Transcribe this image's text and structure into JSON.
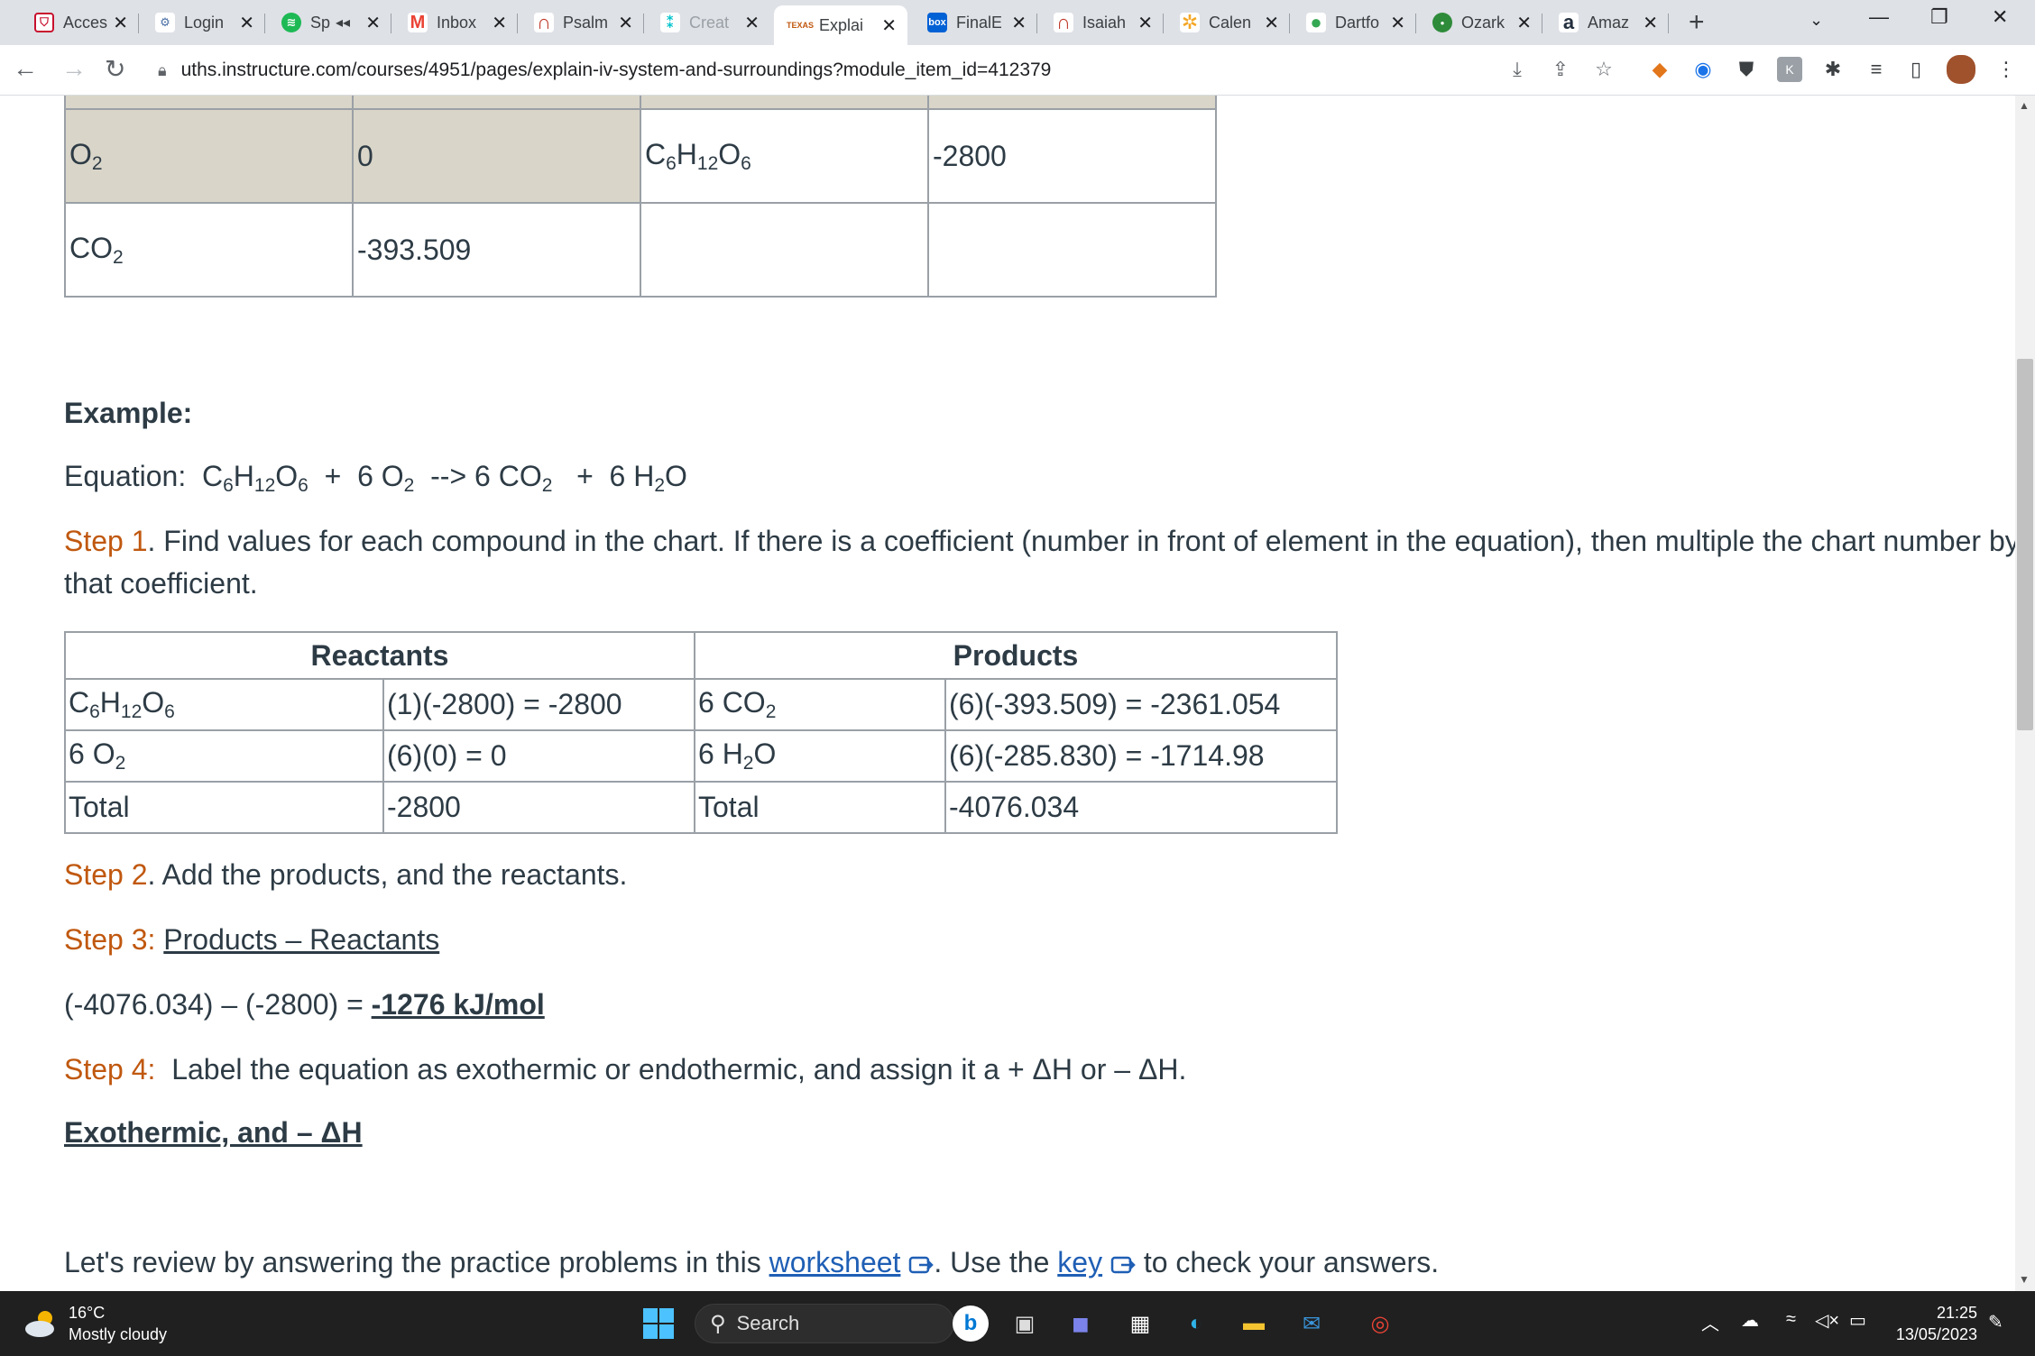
{
  "browser": {
    "tabs": [
      {
        "title": "Acces",
        "fav": "shield-favicon",
        "color": "#c8102e"
      },
      {
        "title": "Login",
        "fav": "login-favicon",
        "color": "#4a6fa5"
      },
      {
        "title": "Sp",
        "fav": "spotify-favicon",
        "color": "#1db954"
      },
      {
        "title": "Inbox",
        "fav": "gmail-favicon",
        "color": "#ea4335"
      },
      {
        "title": "Psalm",
        "fav": "bible-favicon",
        "color": "#c0392b"
      },
      {
        "title": "Creat",
        "fav": "canva-favicon",
        "color": "#00c4cc"
      },
      {
        "title": "Explai",
        "fav": "canvas-favicon",
        "color": "#c0580f"
      },
      {
        "title": "FinalE",
        "fav": "box-favicon",
        "color": "#0061d5"
      },
      {
        "title": "Isaiah",
        "fav": "bible-favicon",
        "color": "#c0392b"
      },
      {
        "title": "Calen",
        "fav": "calendar-favicon",
        "color": "#f4a623"
      },
      {
        "title": "Dartfo",
        "fav": "maps-favicon",
        "color": "#34a853"
      },
      {
        "title": "Ozark",
        "fav": "ozark-favicon",
        "color": "#2e8b3a"
      },
      {
        "title": "Amaz",
        "fav": "amazon-favicon",
        "color": "#232f3e"
      }
    ],
    "url": "uths.instructure.com/courses/4951/pages/explain-iv-system-and-surroundings?module_item_id=412379"
  },
  "table1": {
    "rows": [
      {
        "c1": "O",
        "c1sub": "2",
        "c2": "0",
        "c3": "C",
        "c3sub1": "6",
        "c3mid": "H",
        "c3sub2": "12",
        "c3end": "O",
        "c3sub3": "6",
        "c4": "-2800"
      },
      {
        "c1": "CO",
        "c1sub": "2",
        "c2": "-393.509",
        "c3": "",
        "c4": ""
      }
    ]
  },
  "example": {
    "heading": "Example:",
    "equation_label": "Equation:",
    "step1_label": "Step 1",
    "step1_text": ". Find values for each compound in the chart. If there is a coefficient (number in front of element in the equation), then multiple the chart number by",
    "step1_text2": "that coefficient."
  },
  "table2": {
    "header_reactants": "Reactants",
    "header_products": "Products",
    "r1_calc": "(1)(-2800) = -2800",
    "r2_name": "6 O",
    "r2_calc": "(6)(0) = 0",
    "p1_name": "6 CO",
    "p1_calc": "(6)(-393.509) = -2361.054",
    "p2_name": "6 H",
    "p2_calc": "(6)(-285.830) = -1714.98",
    "total_label": "Total",
    "reactant_total": "-2800",
    "product_total": "-4076.034"
  },
  "steps": {
    "step2_label": "Step 2",
    "step2_text": ". Add the products, and the reactants.",
    "step3_label": "Step 3",
    "step3_text": "Products – Reactants",
    "calc": "(-4076.034) – (-2800) = ",
    "result": "-1276 kJ/mol",
    "step4_label": "Step 4",
    "step4_text": "Label the equation as exothermic or endothermic, and assign it a + ΔH or – ΔH.",
    "answer": "Exothermic, and – ΔH",
    "review_pre": "Let's review by answering the practice problems in this ",
    "worksheet_link": "worksheet",
    "review_mid": ". Use the ",
    "key_link": "key",
    "review_post": " to check your answers."
  },
  "taskbar": {
    "temp": "16°C",
    "weather": "Mostly cloudy",
    "search": "Search",
    "time": "21:25",
    "date": "13/05/2023"
  }
}
